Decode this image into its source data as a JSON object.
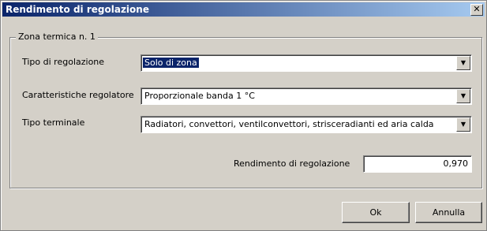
{
  "window": {
    "title": "Rendimento di regolazione",
    "close_label": "✕"
  },
  "group": {
    "label": "Zona termica n. 1"
  },
  "fields": {
    "tipo_regolazione": {
      "label": "Tipo di regolazione",
      "value": "Solo di zona"
    },
    "caratteristiche": {
      "label": "Caratteristiche regolatore",
      "value": "Proporzionale banda 1 °C"
    },
    "tipo_terminale": {
      "label": "Tipo terminale",
      "value": "Radiatori, convettori, ventilconvettori, strisceradianti ed aria calda"
    },
    "rendimento": {
      "label": "Rendimento di regolazione",
      "value": "0,970"
    }
  },
  "buttons": {
    "ok": "Ok",
    "annulla": "Annulla"
  },
  "icons": {
    "dropdown": "chevron-down-icon",
    "close": "close-icon"
  }
}
